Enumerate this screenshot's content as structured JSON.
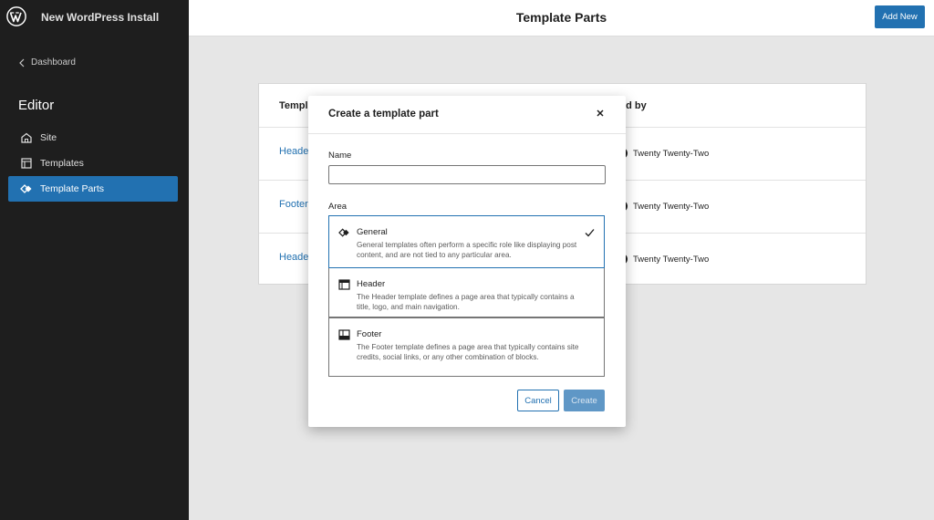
{
  "sidebar": {
    "site_name": "New WordPress Install",
    "back_label": "Dashboard",
    "section_title": "Editor",
    "items": [
      {
        "label": "Site",
        "icon": "home-icon"
      },
      {
        "label": "Templates",
        "icon": "layout-icon"
      },
      {
        "label": "Template Parts",
        "icon": "symbol-diamond-icon",
        "active": true
      }
    ]
  },
  "header": {
    "title": "Template Parts",
    "add_new_label": "Add New"
  },
  "table": {
    "col_template": "Templa",
    "col_added_by": "ed by",
    "rows": [
      {
        "title": "Heade",
        "added_by": "Twenty Twenty-Two"
      },
      {
        "title": "Footer",
        "added_by": "Twenty Twenty-Two"
      },
      {
        "title": "Heade",
        "added_by": "Twenty Twenty-Two"
      }
    ]
  },
  "modal": {
    "title": "Create a template part",
    "name_label": "Name",
    "name_value": "",
    "area_label": "Area",
    "areas": [
      {
        "name": "General",
        "desc": "General templates often perform a specific role like displaying post content, and are not tied to any particular area.",
        "selected": true
      },
      {
        "name": "Header",
        "desc": "The Header template defines a page area that typically contains a title, logo, and main navigation.",
        "selected": false
      },
      {
        "name": "Footer",
        "desc": "The Footer template defines a page area that typically contains site credits, social links, or any other combination of blocks.",
        "selected": false
      }
    ],
    "cancel_label": "Cancel",
    "create_label": "Create"
  },
  "colors": {
    "accent": "#2271b1",
    "sidebar_bg": "#1e1e1e",
    "canvas_bg": "#e6e6e6"
  }
}
